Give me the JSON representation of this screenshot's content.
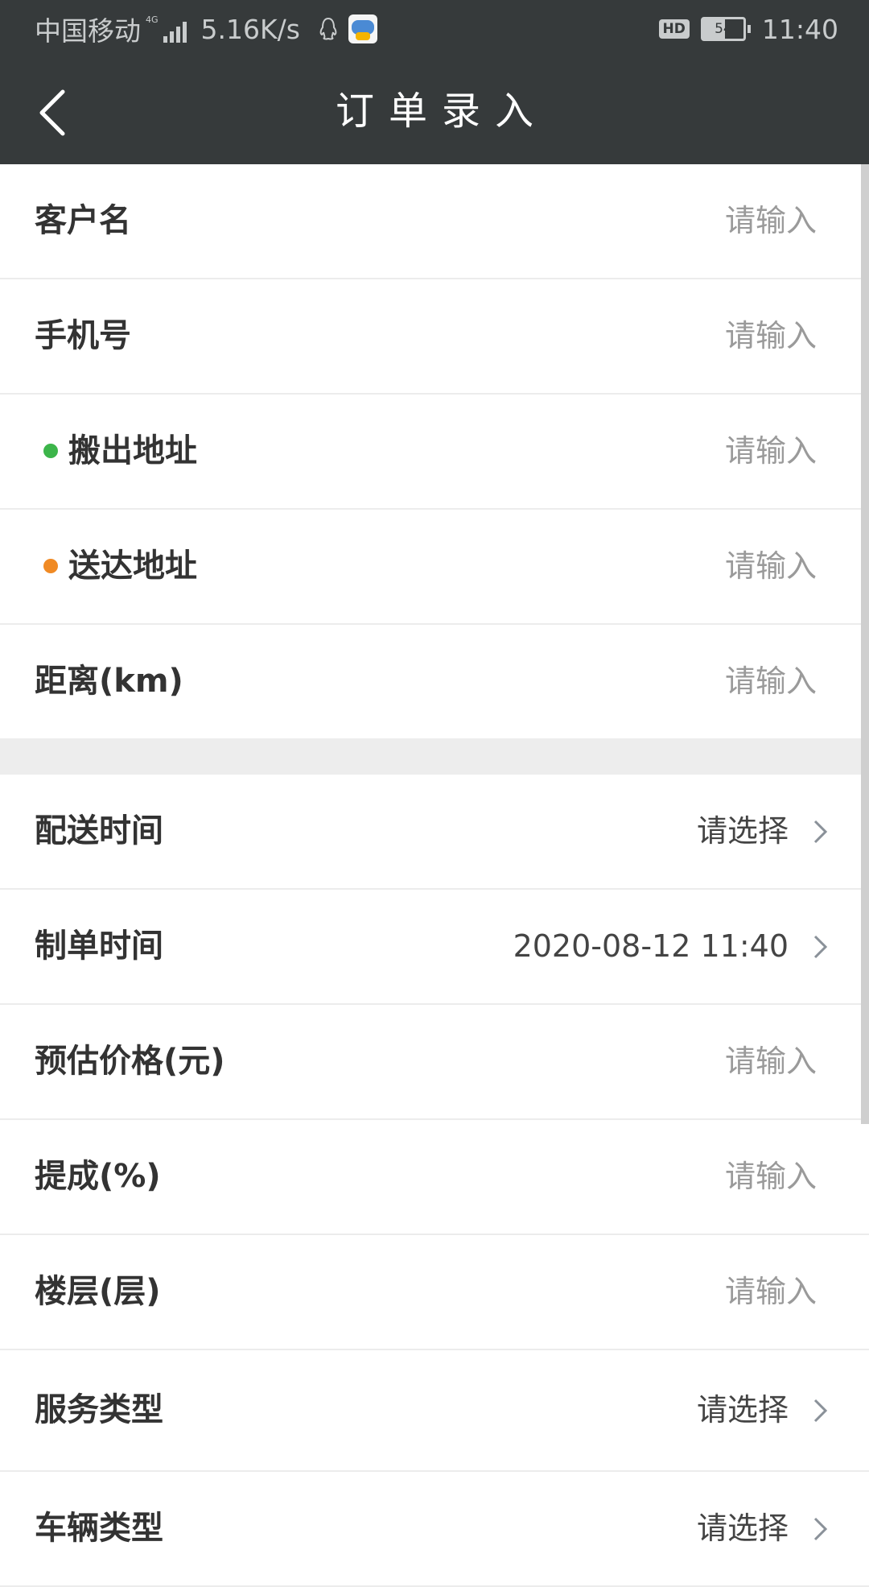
{
  "status_bar": {
    "carrier": "中国移动",
    "network_type": "4G",
    "speed": "5.16K/s",
    "hd": "HD",
    "battery": "54",
    "time": "11:40"
  },
  "header": {
    "title": "订单录入"
  },
  "section1": [
    {
      "label": "客户名",
      "value": "请输入"
    },
    {
      "label": "手机号",
      "value": "请输入"
    },
    {
      "label": "搬出地址",
      "value": "请输入",
      "dot_color": "#3cb54a"
    },
    {
      "label": "送达地址",
      "value": "请输入",
      "dot_color": "#f08a24"
    },
    {
      "label": "距离(km)",
      "value": "请输入"
    }
  ],
  "section2": [
    {
      "label": "配送时间",
      "value": "请选择",
      "has_chevron": true
    },
    {
      "label": "制单时间",
      "value": "2020-08-12 11:40",
      "has_chevron": true
    },
    {
      "label": "预估价格(元)",
      "value": "请输入"
    },
    {
      "label": "提成(%)",
      "value": "请输入"
    },
    {
      "label": "楼层(层)",
      "value": "请输入"
    },
    {
      "label": "服务类型",
      "value": "请选择",
      "has_chevron": true
    },
    {
      "label": "车辆类型",
      "value": "请选择",
      "has_chevron": true
    }
  ],
  "colors": {
    "header_bg": "#363a3b",
    "placeholder": "#9a9a9a",
    "label": "#333333"
  }
}
